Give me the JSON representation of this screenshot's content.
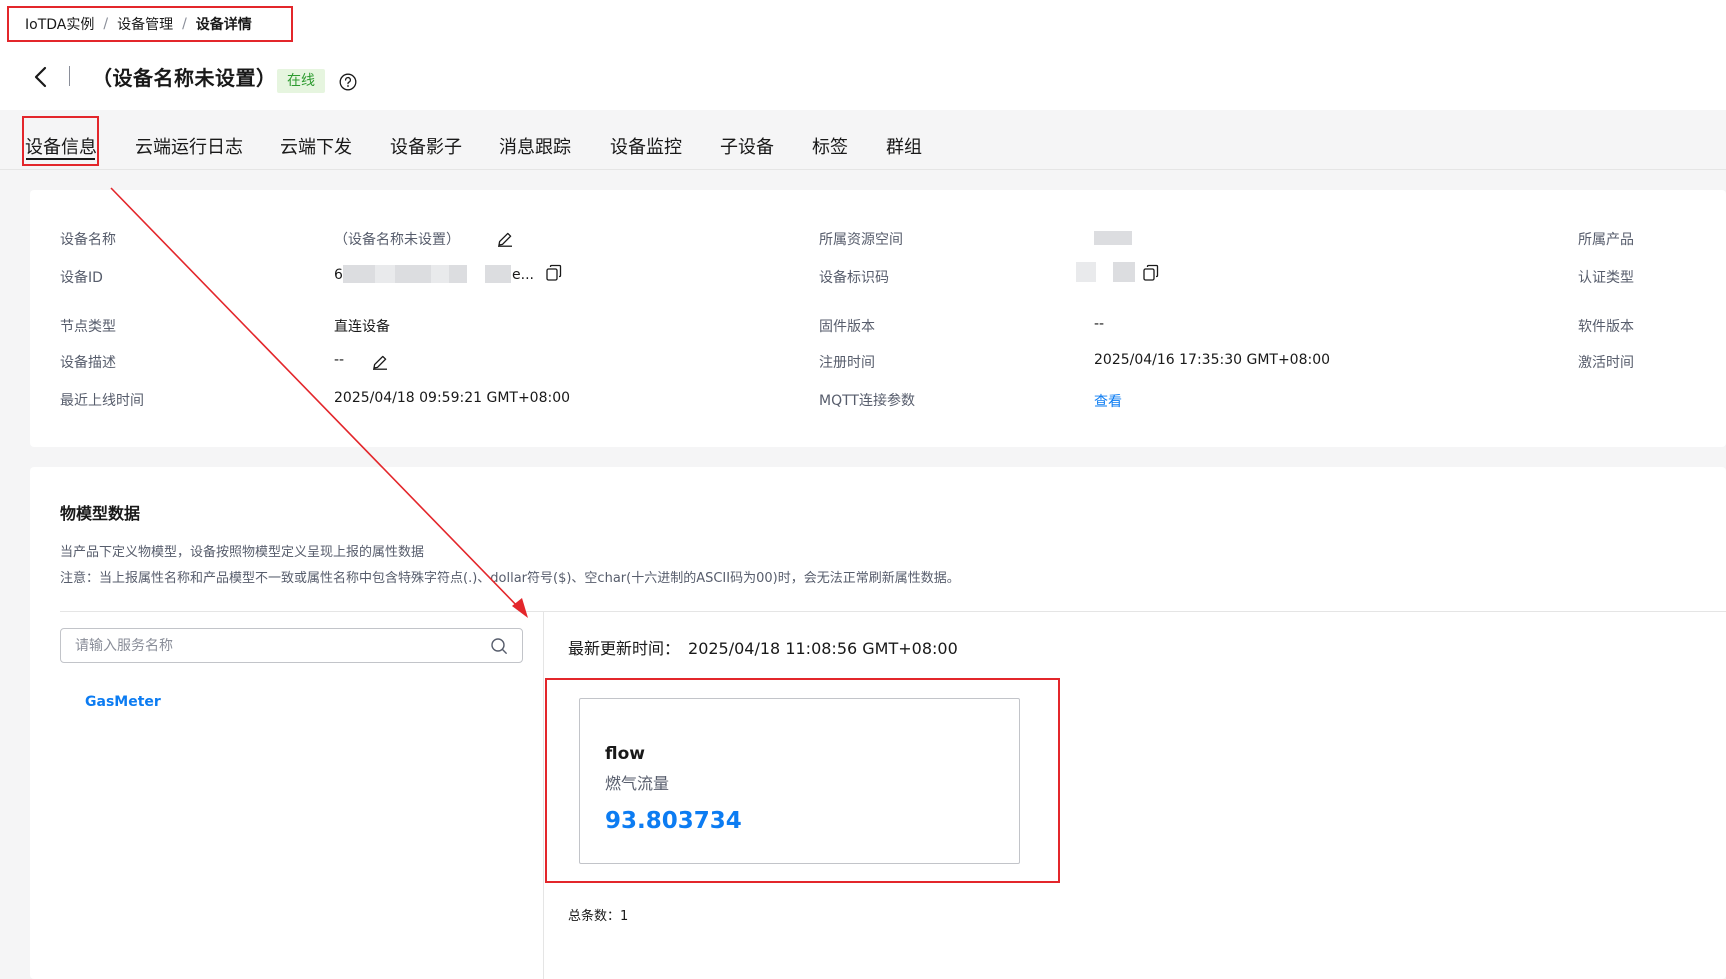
{
  "breadcrumb": {
    "items": [
      "IoTDA实例",
      "设备管理",
      "设备详情"
    ],
    "separator": "/"
  },
  "header": {
    "title": "（设备名称未设置）",
    "status": "在线"
  },
  "tabs": [
    {
      "label": "设备信息",
      "active": true
    },
    {
      "label": "云端运行日志"
    },
    {
      "label": "云端下发"
    },
    {
      "label": "设备影子"
    },
    {
      "label": "消息跟踪"
    },
    {
      "label": "设备监控"
    },
    {
      "label": "子设备"
    },
    {
      "label": "标签"
    },
    {
      "label": "群组"
    }
  ],
  "info": {
    "device_name_label": "设备名称",
    "device_name_value": "（设备名称未设置）",
    "device_id_label": "设备ID",
    "device_id_prefix": "6",
    "device_id_suffix": "e...",
    "node_type_label": "节点类型",
    "node_type_value": "直连设备",
    "device_desc_label": "设备描述",
    "device_desc_value": "--",
    "last_online_label": "最近上线时间",
    "last_online_value": "2025/04/18 09:59:21 GMT+08:00",
    "resource_space_label": "所属资源空间",
    "device_identifier_label": "设备标识码",
    "firmware_label": "固件版本",
    "firmware_value": "--",
    "register_time_label": "注册时间",
    "register_time_value": "2025/04/16 17:35:30 GMT+08:00",
    "mqtt_label": "MQTT连接参数",
    "mqtt_link": "查看",
    "product_label": "所属产品",
    "auth_type_label": "认证类型",
    "software_label": "软件版本",
    "activate_time_label": "激活时间"
  },
  "model": {
    "title": "物模型数据",
    "desc_line1": "当产品下定义物模型，设备按照物模型定义呈现上报的属性数据",
    "desc_line2": "注意：当上报属性名称和产品模型不一致或属性名称中包含特殊字符点(.)、dollar符号($)、空char(十六进制的ASCII码为00)时，会无法正常刷新属性数据。",
    "search_placeholder": "请输入服务名称",
    "services": [
      "GasMeter"
    ],
    "update_label": "最新更新时间：",
    "update_value": "2025/04/18 11:08:56 GMT+08:00",
    "property": {
      "name": "flow",
      "description": "燃气流量",
      "value": "93.803734"
    },
    "total_label": "总条数：",
    "total_value": "1"
  },
  "colors": {
    "accent": "#0c7cf2",
    "highlight": "#e3262b",
    "online_bg": "#e6f5df",
    "online_text": "#2e9b30"
  }
}
